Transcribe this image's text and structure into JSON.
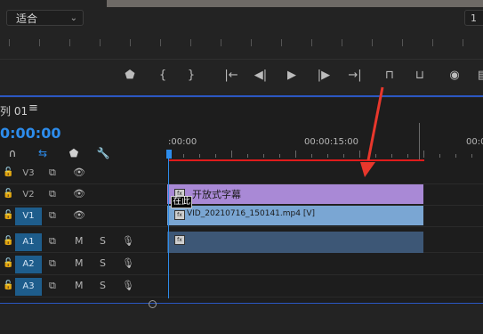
{
  "monitor": {
    "fit_label": "适合",
    "right_tag": "1",
    "transport": [
      {
        "name": "add-marker-button",
        "glyph": "⬟"
      },
      {
        "name": "mark-in-button",
        "glyph": "{"
      },
      {
        "name": "mark-out-button",
        "glyph": "}"
      },
      {
        "name": "go-to-in-button",
        "glyph": "|←"
      },
      {
        "name": "step-back-button",
        "glyph": "◀|"
      },
      {
        "name": "play-button",
        "glyph": "▶"
      },
      {
        "name": "step-forward-button",
        "glyph": "|▶"
      },
      {
        "name": "go-to-out-button",
        "glyph": "→|"
      },
      {
        "name": "lift-button",
        "glyph": "⊓"
      },
      {
        "name": "extract-button",
        "glyph": "⊔"
      },
      {
        "name": "export-frame-button",
        "glyph": "◉"
      },
      {
        "name": "overflow-button",
        "glyph": "▤"
      }
    ]
  },
  "timeline": {
    "sequence_name": "列 01",
    "menu_glyph": "≡",
    "timecode": "0:00:00",
    "ruler_labels": [
      ":00:00",
      "00:00:15:00",
      "00:0"
    ]
  },
  "tracks": [
    {
      "name": "V3",
      "targeted": false
    },
    {
      "name": "V2",
      "targeted": false
    },
    {
      "name": "V1",
      "targeted": true
    },
    {
      "name": "A1",
      "targeted": true
    },
    {
      "name": "A2",
      "targeted": true
    },
    {
      "name": "A3",
      "targeted": true
    }
  ],
  "clips": {
    "caption_label": "开放式字幕",
    "video_label": "VID_20210716_150141.mp4 [V]",
    "fx": "fx",
    "tag": "在此"
  },
  "track_icons": {
    "m": "M",
    "s": "S"
  },
  "colors": {
    "accent": "#2d8ceb",
    "caption_clip": "#a989d6",
    "video_clip": "#7aa6d3",
    "audio_clip": "#3d5776",
    "arrow": "#e8372c"
  }
}
